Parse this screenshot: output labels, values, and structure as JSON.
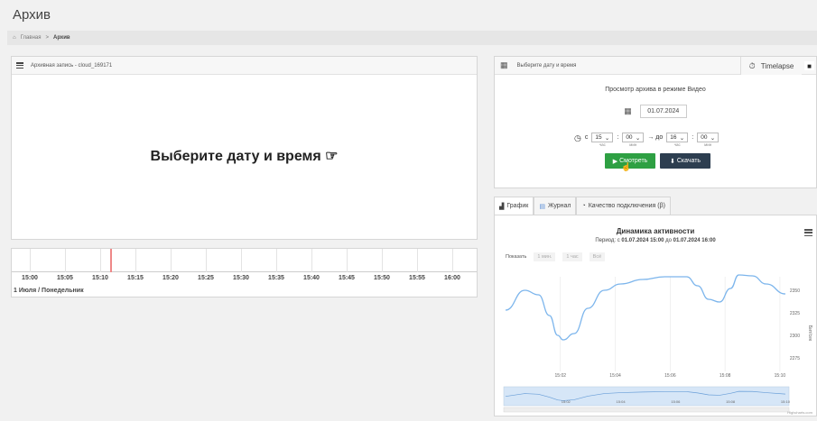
{
  "page": {
    "title": "Архив"
  },
  "breadcrumb": {
    "home_icon": "home-icon",
    "home": "Главная",
    "separator": ">",
    "current": "Архив"
  },
  "video": {
    "header_icon": "menu-icon",
    "header": "Архивная запись - cloud_169171",
    "placeholder": "Выберите дату и время",
    "placeholder_icon": "☞"
  },
  "timeline": {
    "ticks": [
      "15:00",
      "15:05",
      "15:10",
      "15:15",
      "15:20",
      "15:25",
      "15:30",
      "15:35",
      "15:40",
      "15:45",
      "15:50",
      "15:55",
      "16:00"
    ],
    "cursor_fraction": 0.2,
    "date_label": "1 Июля / Понедельник"
  },
  "date_panel": {
    "header": "Выберите дату и время",
    "timelapse": "Timelapse",
    "mode_text": "Просмотр архива в режиме Видео",
    "date_value": "01.07.2024",
    "from_label": "с",
    "from_hour": "15",
    "from_min": "00",
    "to_label": "→ до",
    "to_hour": "16",
    "to_min": "00",
    "unit_hour": "час",
    "unit_min": "мин",
    "watch_label": "Смотреть",
    "download_label": "Скачать"
  },
  "tabs": [
    {
      "label": "График",
      "icon": "chart-icon",
      "active": true
    },
    {
      "label": "Журнал",
      "icon": "log-icon",
      "active": false
    },
    {
      "label": "Качество подключения (β)",
      "icon": "signal-icon",
      "active": false
    }
  ],
  "chart_header": {
    "title": "Динамика активности",
    "subtitle_prefix": "Период: с ",
    "subtitle_from": "01.07.2024 15:00",
    "subtitle_mid": " до ",
    "subtitle_to": "01.07.2024 16:00",
    "zoom_label": "Показать",
    "zoom_options": [
      "1 мин.",
      "1 час",
      "Всё"
    ],
    "credits": "Highcharts.com"
  },
  "colors": {
    "line": "#7cb5ec",
    "navigator_fill": "#d6e6f7",
    "watch": "#2ea043",
    "download": "#2d3e50"
  },
  "chart_data": {
    "type": "line",
    "title": "Динамика активности",
    "xlabel": "",
    "ylabel": "Бит/сек",
    "x_ticks": [
      "15:02",
      "15:04",
      "15:06",
      "15:08",
      "15:10"
    ],
    "y_ticks": [
      2275,
      2300,
      2325,
      2350
    ],
    "ylim": [
      2270,
      2375
    ],
    "xlim_minutes": [
      0,
      10.2
    ],
    "series": [
      {
        "name": "",
        "points": [
          [
            0.0,
            2328
          ],
          [
            0.7,
            2350
          ],
          [
            1.2,
            2345
          ],
          [
            1.6,
            2322
          ],
          [
            1.9,
            2300
          ],
          [
            2.1,
            2295
          ],
          [
            2.5,
            2302
          ],
          [
            3.0,
            2330
          ],
          [
            3.6,
            2350
          ],
          [
            4.2,
            2357
          ],
          [
            5.0,
            2362
          ],
          [
            5.8,
            2365
          ],
          [
            6.6,
            2365
          ],
          [
            7.0,
            2355
          ],
          [
            7.4,
            2340
          ],
          [
            7.8,
            2337
          ],
          [
            8.2,
            2352
          ],
          [
            8.5,
            2367
          ],
          [
            9.0,
            2366
          ],
          [
            9.5,
            2357
          ],
          [
            10.2,
            2346
          ]
        ]
      }
    ],
    "navigator_ticks": [
      "15:02",
      "15:04",
      "15:06",
      "15:08",
      "15:10"
    ],
    "grid": true
  }
}
